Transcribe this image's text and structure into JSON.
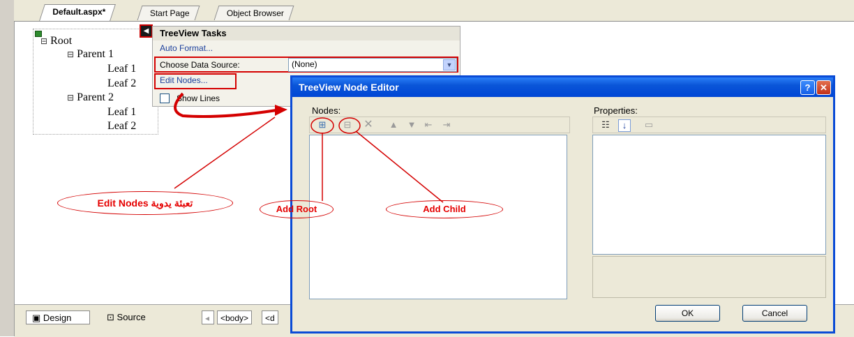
{
  "tabs": [
    {
      "label": "Default.aspx*",
      "active": true
    },
    {
      "label": "Start Page",
      "active": false
    },
    {
      "label": "Object Browser",
      "active": false
    }
  ],
  "tree": {
    "root": "Root",
    "parent1": "Parent 1",
    "p1_leaf1": "Leaf 1",
    "p1_leaf2": "Leaf 2",
    "parent2": "Parent 2",
    "p2_leaf1": "Leaf 1",
    "p2_leaf2": "Leaf 2",
    "expander": "⊟"
  },
  "tasks": {
    "title": "TreeView Tasks",
    "auto_format": "Auto Format...",
    "data_source_label": "Choose Data Source:",
    "data_source_value": "(None)",
    "edit_nodes": "Edit Nodes...",
    "show_lines": "Show Lines",
    "smart_tag_glyph": "◀"
  },
  "bottom": {
    "design": "Design",
    "source": "Source",
    "body_tag": "<body>",
    "next_tag": "<d"
  },
  "dialog": {
    "title": "TreeView Node Editor",
    "help_glyph": "?",
    "close_glyph": "✕",
    "nodes_label": "Nodes:",
    "properties_label": "Properties:",
    "ok": "OK",
    "cancel": "Cancel"
  },
  "annotations": {
    "edit_nodes": "Edit Nodes  تعبئة يدوية",
    "add_root": "Add Root",
    "add_child": "Add Child"
  },
  "colors": {
    "annotation": "#d40000",
    "dialog_title": "#0a55d8",
    "link": "#1b3f9c"
  }
}
